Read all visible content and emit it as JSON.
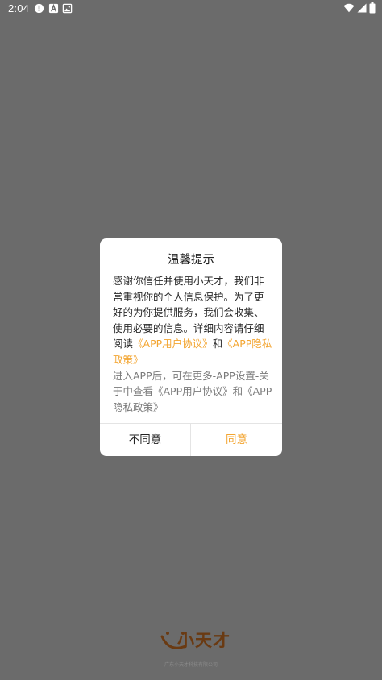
{
  "status_bar": {
    "time": "2:04",
    "icons": [
      "alert-circle-icon",
      "font-a-icon",
      "image-icon"
    ],
    "right_icons": [
      "wifi-icon",
      "cell-signal-icon",
      "battery-icon"
    ]
  },
  "dialog": {
    "title": "温馨提示",
    "body_text": "感谢你信任并使用小天才，我们非常重视你的个人信息保护。为了更好的为你提供服务，我们会收集、使用必要的信息。详细内容请仔细阅读",
    "user_agreement_link": "《APP用户协议》",
    "and_text": "和",
    "privacy_policy_link": "《APP隐私政策》",
    "note_text": "进入APP后，可在更多-APP设置-关于中查看《APP用户协议》和《APP隐私政策》",
    "disagree_label": "不同意",
    "agree_label": "同意",
    "accent_color": "#f3a531"
  },
  "brand": {
    "name": "小天才",
    "company": "广东小天才科技有限公司",
    "color": "#6a3a12"
  }
}
